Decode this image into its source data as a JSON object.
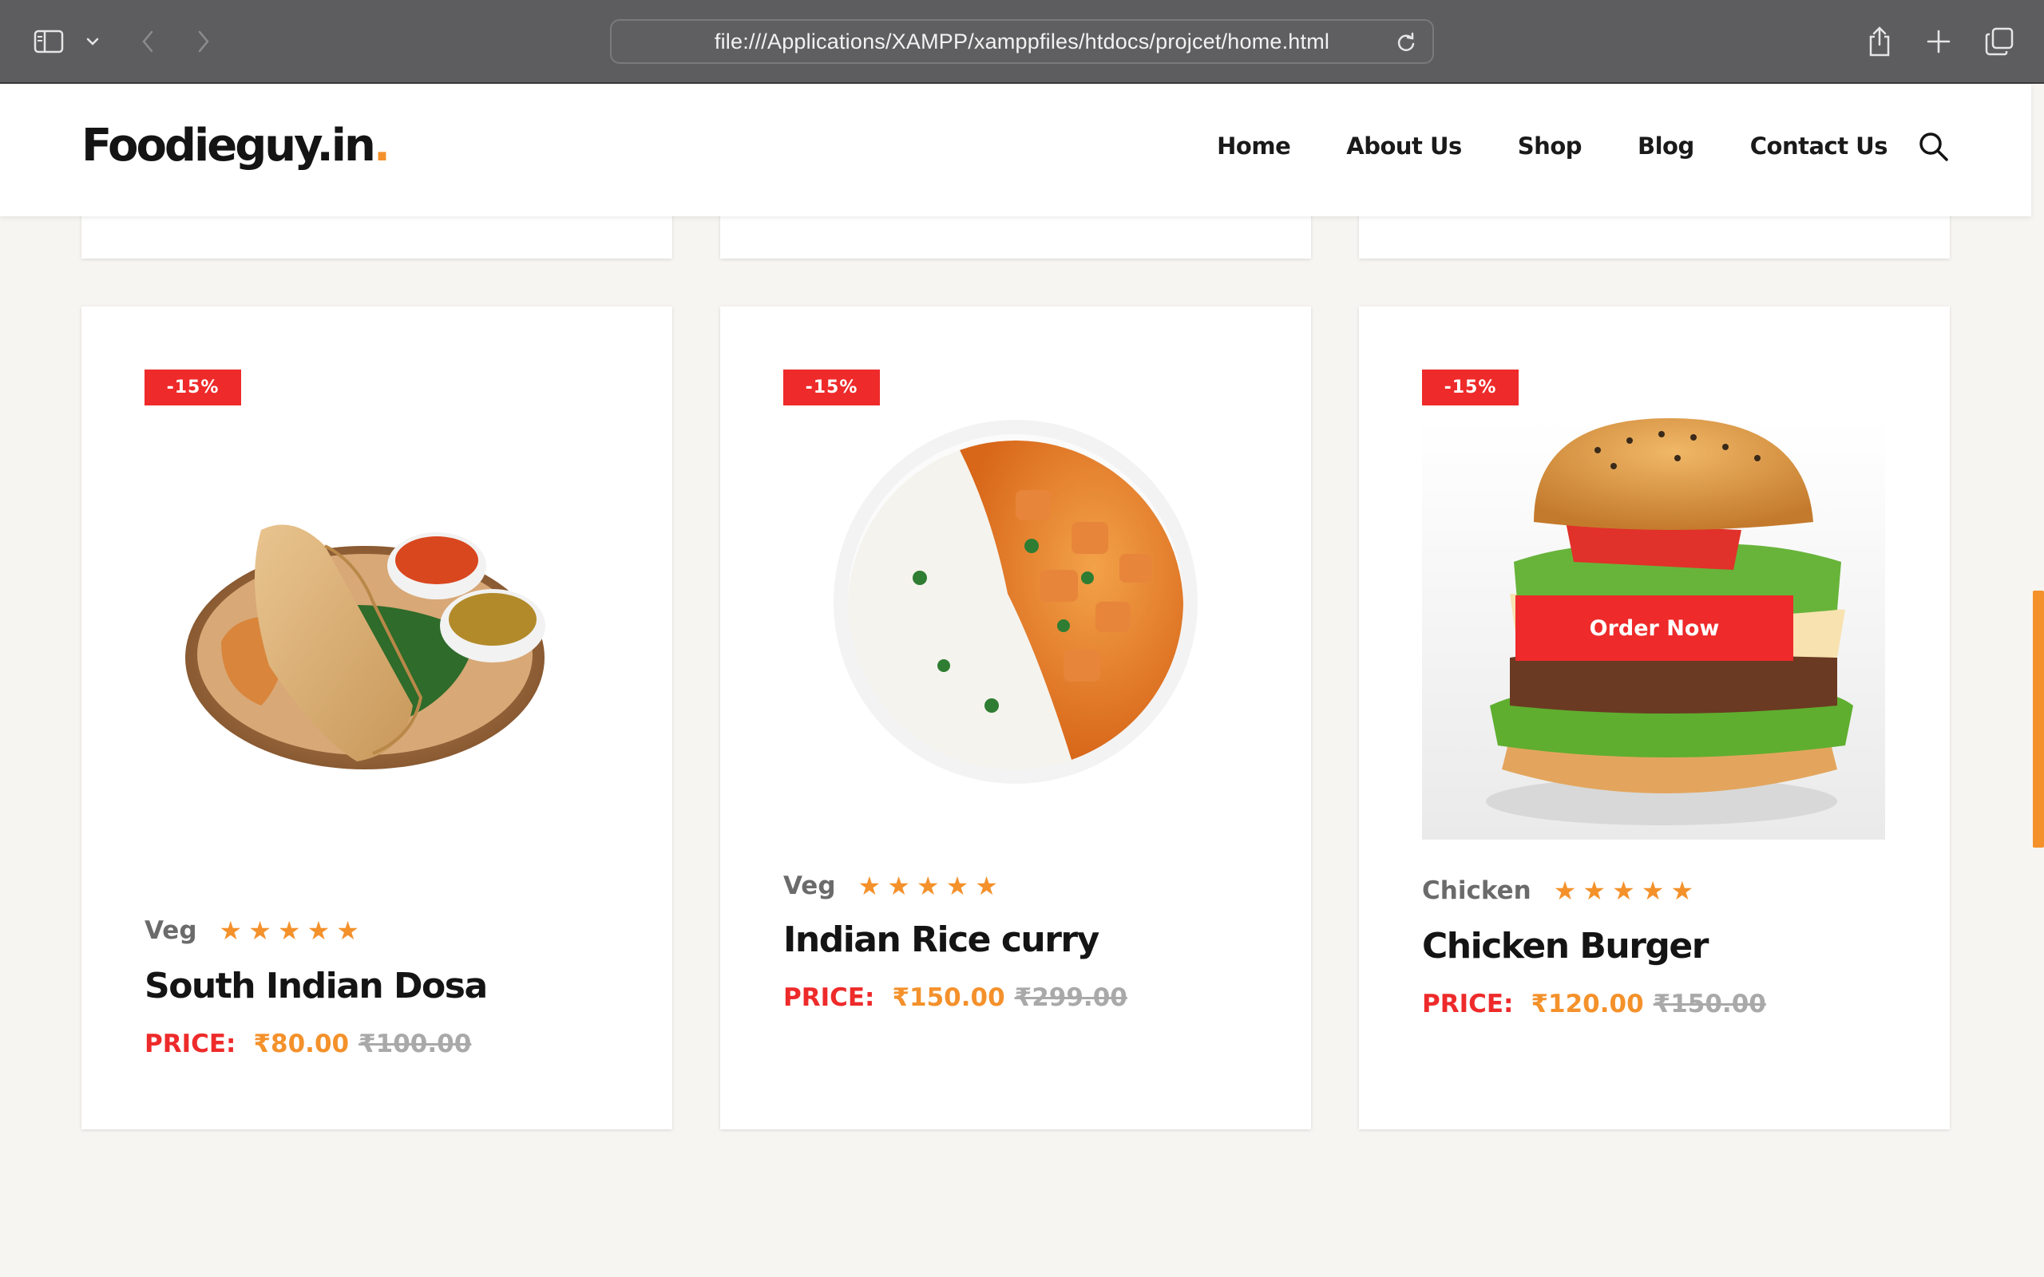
{
  "browser": {
    "url": "file:///Applications/XAMPP/xamppfiles/htdocs/projcet/home.html"
  },
  "site": {
    "logo_text": "Foodieguy.in",
    "logo_dot": ".",
    "nav": [
      "Home",
      "About Us",
      "Shop",
      "Blog",
      "Contact Us"
    ]
  },
  "colors": {
    "accent": "#f4912b",
    "badge": "#ee2a2a",
    "page_bg": "#f7f5f1"
  },
  "products": [
    {
      "badge": "-15%",
      "category": "Veg",
      "rating": 5,
      "name": "South Indian Dosa",
      "price_label": "PRICE:",
      "price": "₹80.00",
      "old_price": "₹100.00",
      "image_icon": "dosa-plate-image"
    },
    {
      "badge": "-15%",
      "category": "Veg",
      "rating": 5,
      "name": "Indian Rice curry",
      "price_label": "PRICE:",
      "price": "₹150.00",
      "old_price": "₹299.00",
      "image_icon": "rice-curry-bowl-image"
    },
    {
      "badge": "-15%",
      "category": "Chicken",
      "rating": 5,
      "name": "Chicken Burger",
      "price_label": "PRICE:",
      "price": "₹120.00",
      "old_price": "₹150.00",
      "image_icon": "chicken-burger-image",
      "hover_button": "Order Now"
    }
  ]
}
